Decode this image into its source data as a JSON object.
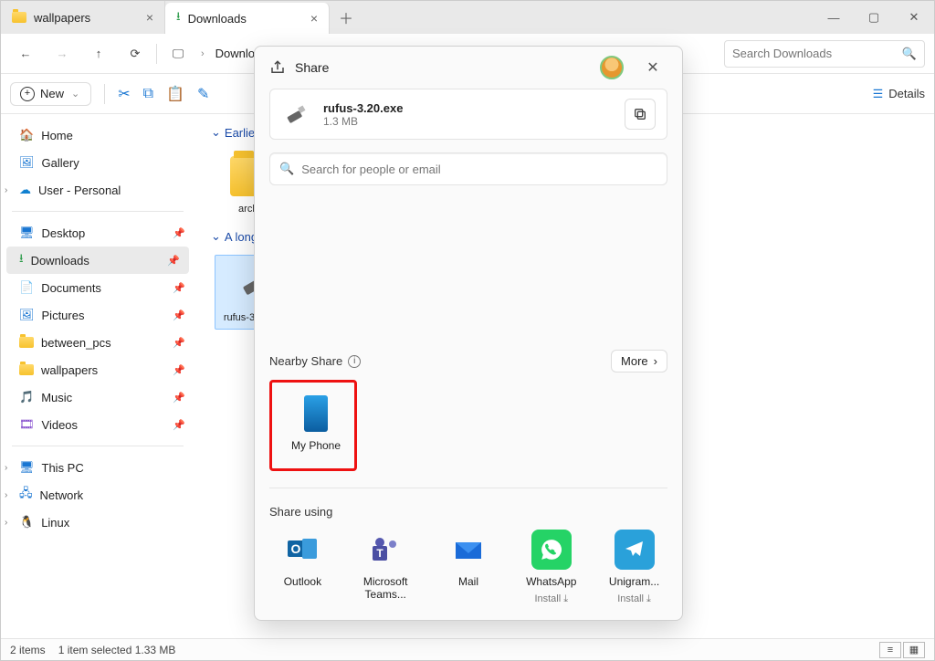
{
  "tabs": [
    {
      "label": "wallpapers",
      "active": false
    },
    {
      "label": "Downloads",
      "active": true
    }
  ],
  "toolbar": {
    "breadcrumb": "Downloads",
    "search_placeholder": "Search Downloads"
  },
  "cmdbar": {
    "new_label": "New",
    "details_label": "Details"
  },
  "sidebar": {
    "top": [
      {
        "label": "Home",
        "icon": "home-icon"
      },
      {
        "label": "Gallery",
        "icon": "gallery-icon"
      },
      {
        "label": "User - Personal",
        "icon": "onedrive-icon",
        "expandable": true
      }
    ],
    "quick": [
      {
        "label": "Desktop",
        "icon": "desktop-icon"
      },
      {
        "label": "Downloads",
        "icon": "downloads-icon",
        "selected": true
      },
      {
        "label": "Documents",
        "icon": "documents-icon"
      },
      {
        "label": "Pictures",
        "icon": "pictures-icon"
      },
      {
        "label": "between_pcs",
        "icon": "folder-icon"
      },
      {
        "label": "wallpapers",
        "icon": "folder-icon"
      },
      {
        "label": "Music",
        "icon": "music-icon"
      },
      {
        "label": "Videos",
        "icon": "videos-icon"
      }
    ],
    "bottom": [
      {
        "label": "This PC",
        "icon": "thispc-icon"
      },
      {
        "label": "Network",
        "icon": "network-icon"
      },
      {
        "label": "Linux",
        "icon": "linux-icon"
      }
    ]
  },
  "content": {
    "group1_label": "Earlier this ...",
    "group1_item": "archival",
    "group2_label": "A long time ago",
    "group2_item": "rufus-3.20.exe"
  },
  "statusbar": {
    "count": "2 items",
    "selection": "1 item selected  1.33 MB"
  },
  "share": {
    "title": "Share",
    "file_name": "rufus-3.20.exe",
    "file_size": "1.3 MB",
    "search_placeholder": "Search for people or email",
    "nearby_label": "Nearby Share",
    "more_label": "More",
    "device_label": "My Phone",
    "share_using_label": "Share using",
    "apps": [
      {
        "label": "Outlook",
        "sub": "",
        "color": "#fff",
        "icon": "outlook"
      },
      {
        "label": "Microsoft Teams...",
        "sub": "",
        "color": "#fff",
        "icon": "teams"
      },
      {
        "label": "Mail",
        "sub": "",
        "color": "#fff",
        "icon": "mail"
      },
      {
        "label": "WhatsApp",
        "sub": "Install ⤓",
        "color": "#25d366",
        "icon": "whatsapp"
      },
      {
        "label": "Unigram...",
        "sub": "Install ⤓",
        "color": "#2aa1da",
        "icon": "telegram"
      }
    ]
  }
}
